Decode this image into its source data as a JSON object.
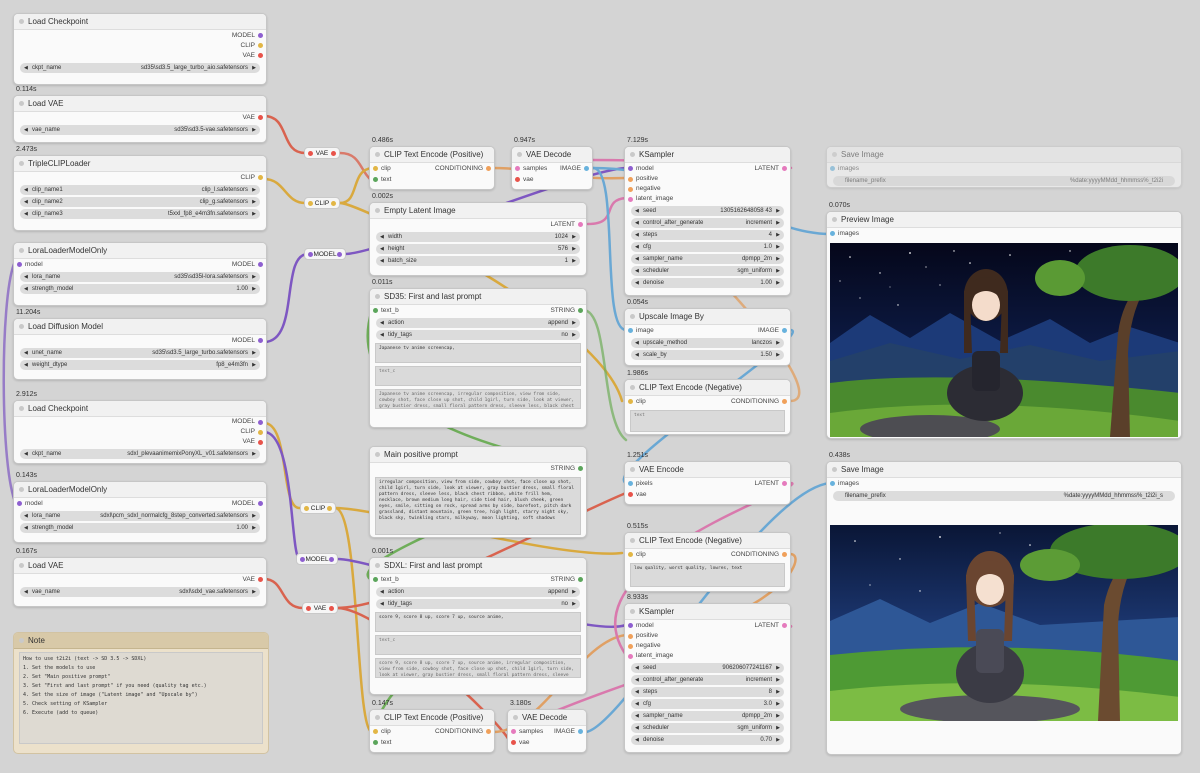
{
  "colors": {
    "model": "#8e5fd0",
    "clip": "#e2b645",
    "vae": "#e8534a",
    "conditioning": "#f0a05a",
    "latent": "#e57abd",
    "image": "#68b2dd",
    "string": "#5ba55b",
    "wire_model": "#7e57c2",
    "wire_clip": "#d9a93e",
    "wire_vae": "#d9634f",
    "wire_cond": "#e0a064",
    "wire_latent": "#d979ad",
    "wire_image": "#6aa8d4",
    "wire_string": "#6fae5a"
  },
  "nodes": {
    "load_checkpoint_1": {
      "title": "Load Checkpoint",
      "outputs": [
        "MODEL",
        "CLIP",
        "VAE"
      ],
      "ckpt_label": "ckpt_name",
      "ckpt_value": "sd35\\sd3.5_large_turbo_aio.safetensors"
    },
    "load_vae_1": {
      "time": "0.114s",
      "title": "Load VAE",
      "output": "VAE",
      "label": "vae_name",
      "value": "sd35\\sd3.5-vae.safetensors"
    },
    "triple_clip": {
      "time": "2.473s",
      "title": "TripleCLIPLoader",
      "output": "CLIP",
      "w1_label": "clip_name1",
      "w1_value": "clip_l.safetensors",
      "w2_label": "clip_name2",
      "w2_value": "clip_g.safetensors",
      "w3_label": "clip_name3",
      "w3_value": "t5xxl_fp8_e4m3fn.safetensors"
    },
    "lora_1": {
      "title": "LoraLoaderModelOnly",
      "input": "model",
      "output": "MODEL",
      "w1_label": "lora_name",
      "w1_value": "sd35\\sd35l-lora.safetensors",
      "w2_label": "strength_model",
      "w2_value": "1.00"
    },
    "diffusion": {
      "time": "11.204s",
      "title": "Load Diffusion Model",
      "output": "MODEL",
      "w1_label": "unet_name",
      "w1_value": "sd35\\sd3.5_large_turbo.safetensors",
      "w2_label": "weight_dtype",
      "w2_value": "fp8_e4m3fn"
    },
    "load_checkpoint_2": {
      "time": "2.912s",
      "title": "Load Checkpoint",
      "outputs": [
        "MODEL",
        "CLIP",
        "VAE"
      ],
      "ckpt_label": "ckpt_name",
      "ckpt_value": "sdxl_plevaanimemixPonyXL_v01.safetensors"
    },
    "lora_2": {
      "time": "0.143s",
      "title": "LoraLoaderModelOnly",
      "input": "model",
      "output": "MODEL",
      "w1_label": "lora_name",
      "w1_value": "sdxl\\pcm_sdxl_normalcfg_8step_converted.safetensors",
      "w2_label": "strength_model",
      "w2_value": "1.00"
    },
    "load_vae_2": {
      "time": "0.167s",
      "title": "Load VAE",
      "output": "VAE",
      "label": "vae_name",
      "value": "sdxl\\sdxl_vae.safetensors"
    },
    "clip_pos_1": {
      "time": "0.486s",
      "title": "CLIP Text Encode (Positive)",
      "in1": "clip",
      "in2": "text",
      "output": "CONDITIONING"
    },
    "vae_decode_1": {
      "time": "0.947s",
      "title": "VAE Decode",
      "in1": "samples",
      "in2": "vae",
      "output": "IMAGE"
    },
    "empty_latent": {
      "time": "0.002s",
      "title": "Empty Latent Image",
      "output": "LATENT",
      "w1_label": "width",
      "w1_value": "1024",
      "w2_label": "height",
      "w2_value": "576",
      "w3_label": "batch_size",
      "w3_value": "1"
    },
    "sd35_prompt": {
      "time": "0.011s",
      "title": "SD35: First and last prompt",
      "input": "text_b",
      "output": "STRING",
      "w1_label": "action",
      "w1_value": "append",
      "w2_label": "tidy_tags",
      "w2_value": "no",
      "t1": "Japanese tv anime screencap,",
      "t2": "text_c",
      "t3": "Japanese tv anime screencap, irregular composition, view from side, cowboy shot, face close up shot, child 1girl, turn side, look at viewer, gray bustier dress, small floral pattern dress, sleeve less, black chest ribbon, white frill hem, necklace,"
    },
    "main_prompt": {
      "title": "Main positive prompt",
      "output": "STRING",
      "text": "irregular composition, view from side, cowboy shot, face close up shot, child 1girl, turn side, look at viewer, gray bustier dress, small floral pattern dress, sleeve less, black chest ribbon, white frill hem, necklace, brown medium long hair, side tied hair, blush cheek, green eyes, smile, sitting on rock, spread arms by side, barefoot, pitch dark grassland, distant mountain, green tree, high light, starry night sky, black sky, twinkling stars, milkyway, moon lighting, soft shadows"
    },
    "sdxl_prompt": {
      "time": "0.001s",
      "title": "SDXL: First and last prompt",
      "input": "text_b",
      "output": "STRING",
      "w1_label": "action",
      "w1_value": "append",
      "w2_label": "tidy_tags",
      "w2_value": "no",
      "t1": "score 9, score 8 up, score 7 up, source anime,",
      "t2": "text_c",
      "t3": "score 9, score 8 up, score 7 up, source anime, irregular composition, view from side, cowboy shot, face close up shot, child 1girl, turn side, look at viewer, gray bustier dress, small floral pattern dress, sleeve less, black chest ribbon,"
    },
    "clip_pos_2": {
      "time": "0.147s",
      "title": "CLIP Text Encode (Positive)",
      "in1": "clip",
      "in2": "text",
      "output": "CONDITIONING"
    },
    "vae_decode_2": {
      "time": "3.180s",
      "title": "VAE Decode",
      "in1": "samples",
      "in2": "vae",
      "output": "IMAGE"
    },
    "ksampler_1": {
      "time": "7.129s",
      "title": "KSampler",
      "inputs": [
        "model",
        "positive",
        "negative",
        "latent_image"
      ],
      "output": "LATENT",
      "widgets": [
        {
          "label": "seed",
          "value": "1305162648058 43"
        },
        {
          "label": "control_after_generate",
          "value": "increment"
        },
        {
          "label": "steps",
          "value": "4"
        },
        {
          "label": "cfg",
          "value": "1.0"
        },
        {
          "label": "sampler_name",
          "value": "dpmpp_2m"
        },
        {
          "label": "scheduler",
          "value": "sgm_uniform"
        },
        {
          "label": "denoise",
          "value": "1.00"
        }
      ]
    },
    "upscale": {
      "time": "0.054s",
      "title": "Upscale Image By",
      "input": "image",
      "output": "IMAGE",
      "w1_label": "upscale_method",
      "w1_value": "lanczos",
      "w2_label": "scale_by",
      "w2_value": "1.50"
    },
    "clip_neg_1": {
      "time": "1.986s",
      "title": "CLIP Text Encode (Negative)",
      "input": "clip",
      "output": "CONDITIONING",
      "text": "text"
    },
    "vae_encode": {
      "time": "1.251s",
      "title": "VAE Encode",
      "in1": "pixels",
      "in2": "vae",
      "output": "LATENT"
    },
    "clip_neg_2": {
      "time": "0.515s",
      "title": "CLIP Text Encode (Negative)",
      "input": "clip",
      "output": "CONDITIONING",
      "text": "low quality, worst quality, lowres, text"
    },
    "ksampler_2": {
      "time": "8.933s",
      "title": "KSampler",
      "inputs": [
        "model",
        "positive",
        "negative",
        "latent_image"
      ],
      "output": "LATENT",
      "widgets": [
        {
          "label": "seed",
          "value": "906206077241167"
        },
        {
          "label": "control_after_generate",
          "value": "increment"
        },
        {
          "label": "steps",
          "value": "8"
        },
        {
          "label": "cfg",
          "value": "3.0"
        },
        {
          "label": "sampler_name",
          "value": "dpmpp_2m"
        },
        {
          "label": "scheduler",
          "value": "sgm_uniform"
        },
        {
          "label": "denoise",
          "value": "0.70"
        }
      ]
    },
    "save_image_1": {
      "title": "Save Image",
      "input": "images",
      "w_label": "filename_prefix",
      "w_value": "%date:yyyyMMdd_hhmmss%_t2i2i"
    },
    "preview_image": {
      "time": "0.070s",
      "title": "Preview Image",
      "input": "images"
    },
    "save_image_2": {
      "time": "0.438s",
      "title": "Save Image",
      "input": "images",
      "w_label": "filename_prefix",
      "w_value": "%date:yyyyMMdd_hhmmss%_t2i2i_s"
    }
  },
  "reroutes": {
    "vae_1": "VAE",
    "clip_1": "CLIP",
    "model_1": "MODEL",
    "clip_2": "CLIP",
    "model_2": "MODEL",
    "vae_2": "VAE"
  },
  "note": {
    "title": "Note",
    "lines": [
      "How to use t2i2i (text -> SD 3.5 -> SDXL)",
      "1. Set the models to use",
      "2. Set \"Main positive prompt\"",
      "3. Set \"First and last prompt\" if you need (quality tag etc.)",
      "4. Set the size of image (\"Latent image\" and \"Upscale by\")",
      "5. Check setting of KSampler",
      "6. Execute (add to queue)"
    ]
  }
}
